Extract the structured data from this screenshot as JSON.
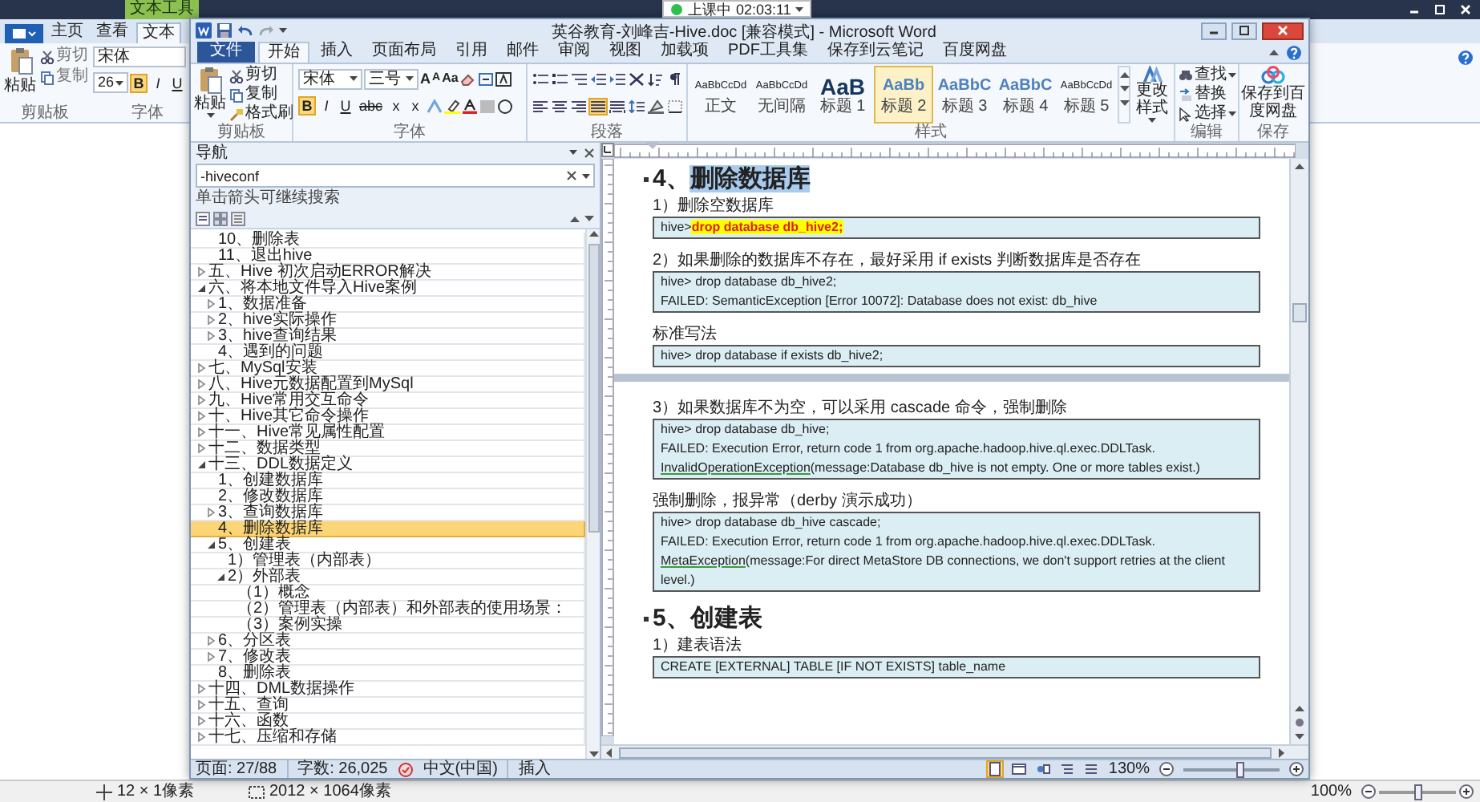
{
  "recording": {
    "label": "上课中",
    "time": "02:03:11"
  },
  "paint": {
    "context_tab": "文本工具",
    "tabs": [
      {
        "label": "主页",
        "selected": false
      },
      {
        "label": "查看",
        "selected": false
      },
      {
        "label": "文本",
        "selected": true
      }
    ],
    "clipboard": {
      "paste": "粘贴",
      "cut": "剪切",
      "copy": "复制",
      "label": "剪贴板"
    },
    "font": {
      "family": "宋体",
      "size": "26",
      "toggles": [
        {
          "label": "B",
          "on": true
        },
        {
          "label": "I",
          "on": false
        },
        {
          "label": "U",
          "on": false
        }
      ],
      "label": "字体"
    },
    "status": {
      "cursor": "12 × 1像素",
      "selection": "2012 × 1064像素",
      "zoom": "100%",
      "slider": {
        "level": 0.5
      }
    }
  },
  "word": {
    "title": "英谷教育-刘峰吉-Hive.doc [兼容模式] - Microsoft Word",
    "tabs": [
      {
        "label": "文件",
        "kind": "file",
        "selected": false
      },
      {
        "label": "开始",
        "kind": "tab",
        "selected": true
      },
      {
        "label": "插入",
        "kind": "tab",
        "selected": false
      },
      {
        "label": "页面布局",
        "kind": "tab",
        "selected": false
      },
      {
        "label": "引用",
        "kind": "tab",
        "selected": false
      },
      {
        "label": "邮件",
        "kind": "tab",
        "selected": false
      },
      {
        "label": "审阅",
        "kind": "tab",
        "selected": false
      },
      {
        "label": "视图",
        "kind": "tab",
        "selected": false
      },
      {
        "label": "加载项",
        "kind": "tab",
        "selected": false
      },
      {
        "label": "PDF工具集",
        "kind": "tab",
        "selected": false
      },
      {
        "label": "保存到云笔记",
        "kind": "tab",
        "selected": false
      },
      {
        "label": "百度网盘",
        "kind": "tab",
        "selected": false
      }
    ],
    "clipboard": {
      "paste": "粘贴",
      "cut": "剪切",
      "copy": "复制",
      "format_painter": "格式刷",
      "label": "剪贴板"
    },
    "font": {
      "family": "宋体",
      "size": "三号",
      "size_buttons": [
        {
          "label": "A",
          "kind": "grow"
        },
        {
          "label": "A",
          "kind": "shrink"
        },
        {
          "label": "Aa",
          "kind": "case"
        }
      ],
      "format_buttons": [
        {
          "label": "B",
          "kind": "bold",
          "on": true
        },
        {
          "label": "I",
          "kind": "italic",
          "on": false
        },
        {
          "label": "U",
          "kind": "underline",
          "on": false
        },
        {
          "label": "abc",
          "kind": "strike",
          "on": false
        },
        {
          "label": "x",
          "kind": "sub",
          "on": false
        },
        {
          "label": "x",
          "kind": "super",
          "on": false
        }
      ],
      "label": "字体"
    },
    "paragraph": {
      "align": [
        {
          "selected": false
        },
        {
          "selected": false
        },
        {
          "selected": false
        },
        {
          "selected": true
        },
        {
          "selected": false
        }
      ],
      "label": "段落"
    },
    "styles": {
      "items": [
        {
          "sample": "AaBbCcDd",
          "label": "正文",
          "kind": "small",
          "selected": false
        },
        {
          "sample": "AaBbCcDd",
          "label": "无间隔",
          "kind": "small",
          "selected": false
        },
        {
          "sample": "AaB",
          "label": "标题 1",
          "kind": "large",
          "selected": false
        },
        {
          "sample": "AaBb",
          "label": "标题 2",
          "kind": "medium",
          "selected": true
        },
        {
          "sample": "AaBbC",
          "label": "标题 3",
          "kind": "medium",
          "selected": false
        },
        {
          "sample": "AaBbC",
          "label": "标题 4",
          "kind": "medium",
          "selected": false
        },
        {
          "sample": "AaBbCcDd",
          "label": "标题 5",
          "kind": "small",
          "selected": false
        }
      ],
      "change": "更改样式",
      "label": "样式"
    },
    "editing": {
      "find": "查找",
      "replace": "替换",
      "select": "选择",
      "label": "编辑"
    },
    "save": {
      "button": "保存到百度网盘",
      "label": "保存"
    },
    "nav": {
      "title": "导航",
      "search": "-hiveconf",
      "hint": "单击箭头可继续搜索",
      "tree": [
        {
          "children": [
            {
              "text": "10、删除表",
              "selected": false
            },
            {
              "text": "11、退出hive",
              "selected": false
            }
          ]
        },
        {
          "text": "五、Hive 初次启动ERROR解决",
          "selected": false,
          "expanded": false
        },
        {
          "text": "六、将本地文件导入Hive案例",
          "selected": false,
          "expanded": true,
          "children": [
            {
              "text": "1、数据准备",
              "selected": false,
              "expanded": false
            },
            {
              "text": "2、hive实际操作",
              "selected": false,
              "expanded": false
            },
            {
              "text": "3、hive查询结果",
              "selected": false,
              "expanded": false
            },
            {
              "text": "4、遇到的问题",
              "selected": false
            }
          ]
        },
        {
          "text": "七、MySql安装",
          "selected": false,
          "expanded": false
        },
        {
          "text": "八、Hive元数据配置到MySql",
          "selected": false,
          "expanded": false
        },
        {
          "text": "九、Hive常用交互命令",
          "selected": false,
          "expanded": false
        },
        {
          "text": "十、Hive其它命令操作",
          "selected": false,
          "expanded": false
        },
        {
          "text": "十一、Hive常见属性配置",
          "selected": false,
          "expanded": false
        },
        {
          "text": "十二、数据类型",
          "selected": false,
          "expanded": false
        },
        {
          "text": "十三、DDL数据定义",
          "selected": false,
          "expanded": true,
          "children": [
            {
              "text": "1、创建数据库",
              "selected": false
            },
            {
              "text": "2、修改数据库",
              "selected": false
            },
            {
              "text": "3、查询数据库",
              "selected": false,
              "expanded": false
            },
            {
              "text": "4、删除数据库",
              "selected": true
            },
            {
              "text": "5、创建表",
              "selected": false,
              "expanded": true,
              "children": [
                {
                  "text": "1）管理表（内部表）",
                  "selected": false
                },
                {
                  "text": "2）外部表",
                  "selected": false,
                  "expanded": true,
                  "children": [
                    {
                      "text": "（1）概念",
                      "selected": false
                    },
                    {
                      "text": "（2）管理表（内部表）和外部表的使用场景：",
                      "selected": false
                    },
                    {
                      "text": "（3）案例实操",
                      "selected": false
                    }
                  ]
                }
              ]
            },
            {
              "text": "6、分区表",
              "selected": false,
              "expanded": false
            },
            {
              "text": "7、修改表",
              "selected": false,
              "expanded": false
            },
            {
              "text": "8、删除表",
              "selected": false
            }
          ]
        },
        {
          "text": "十四、DML数据操作",
          "selected": false,
          "expanded": false
        },
        {
          "text": "十五、查询",
          "selected": false,
          "expanded": false
        },
        {
          "text": "十六、函数",
          "selected": false,
          "expanded": false
        },
        {
          "text": "十七、压缩和存储",
          "selected": false,
          "expanded": false
        }
      ]
    },
    "document": [
      {
        "kind": "heading",
        "number": "4、",
        "text": "删除数据库",
        "selected": true
      },
      {
        "kind": "para",
        "text": "1）删除空数据库"
      },
      {
        "kind": "code",
        "lines": [
          [
            {
              "text": "hive>",
              "kind": "plain"
            },
            {
              "text": "drop database db_hive2;",
              "kind": "highlight"
            }
          ]
        ]
      },
      {
        "kind": "blank"
      },
      {
        "kind": "para",
        "text": "2）如果删除的数据库不存在，最好采用  if exists 判断数据库是否存在"
      },
      {
        "kind": "code",
        "lines": [
          [
            {
              "text": "hive> drop database db_hive2;",
              "kind": "plain"
            }
          ],
          [
            {
              "text": "FAILED: SemanticException [Error 10072]: Database does not exist: db_hive",
              "kind": "plain"
            }
          ]
        ]
      },
      {
        "kind": "blank"
      },
      {
        "kind": "para",
        "text": "标准写法"
      },
      {
        "kind": "code",
        "lines": [
          [
            {
              "text": "hive> drop database if exists db_hive2;",
              "kind": "plain"
            }
          ]
        ]
      },
      {
        "kind": "page_break"
      },
      {
        "kind": "blank"
      },
      {
        "kind": "para",
        "text": "3）如果数据库不为空，可以采用 cascade 命令，强制删除"
      },
      {
        "kind": "code",
        "lines": [
          [
            {
              "text": "hive> drop database db_hive;",
              "kind": "plain"
            }
          ],
          [
            {
              "text": "FAILED: Execution Error, return code 1 from org.apache.hadoop.hive.ql.exec.DDLTask.",
              "kind": "plain"
            }
          ],
          [
            {
              "text": "InvalidOperationException",
              "kind": "flagged"
            },
            {
              "text": "(message:Database db_hive  is not empty. One or more tables exist.)",
              "kind": "plain"
            }
          ]
        ]
      },
      {
        "kind": "blank"
      },
      {
        "kind": "para",
        "text": "强制删除，报异常（derby  演示成功）"
      },
      {
        "kind": "code",
        "lines": [
          [
            {
              "text": "hive> drop database db_hive  cascade;",
              "kind": "plain"
            }
          ],
          [
            {
              "text": "FAILED: Execution Error, return code 1 from org.apache.hadoop.hive.ql.exec.DDLTask.",
              "kind": "plain"
            }
          ],
          [
            {
              "text": "MetaException",
              "kind": "flagged"
            },
            {
              "text": "(message:For direct MetaStore DB connections, we don't support retries at the client level.)",
              "kind": "plain"
            }
          ]
        ]
      },
      {
        "kind": "blank"
      },
      {
        "kind": "heading",
        "number": "5、",
        "text": "创建表",
        "selected": false
      },
      {
        "kind": "para",
        "text": "1）建表语法"
      },
      {
        "kind": "code",
        "lines": [
          [
            {
              "text": "CREATE [EXTERNAL] TABLE [IF NOT EXISTS] table_name",
              "kind": "plain"
            }
          ]
        ]
      }
    ],
    "status": {
      "page": "页面: 27/88",
      "words": "字数: 26,025",
      "language": "中文(中国)",
      "mode": "插入",
      "views": [
        {
          "selected": true
        },
        {
          "selected": false
        },
        {
          "selected": false
        },
        {
          "selected": false
        },
        {
          "selected": false
        }
      ],
      "zoom": "130%",
      "slider": {
        "level": 0.6
      }
    }
  }
}
